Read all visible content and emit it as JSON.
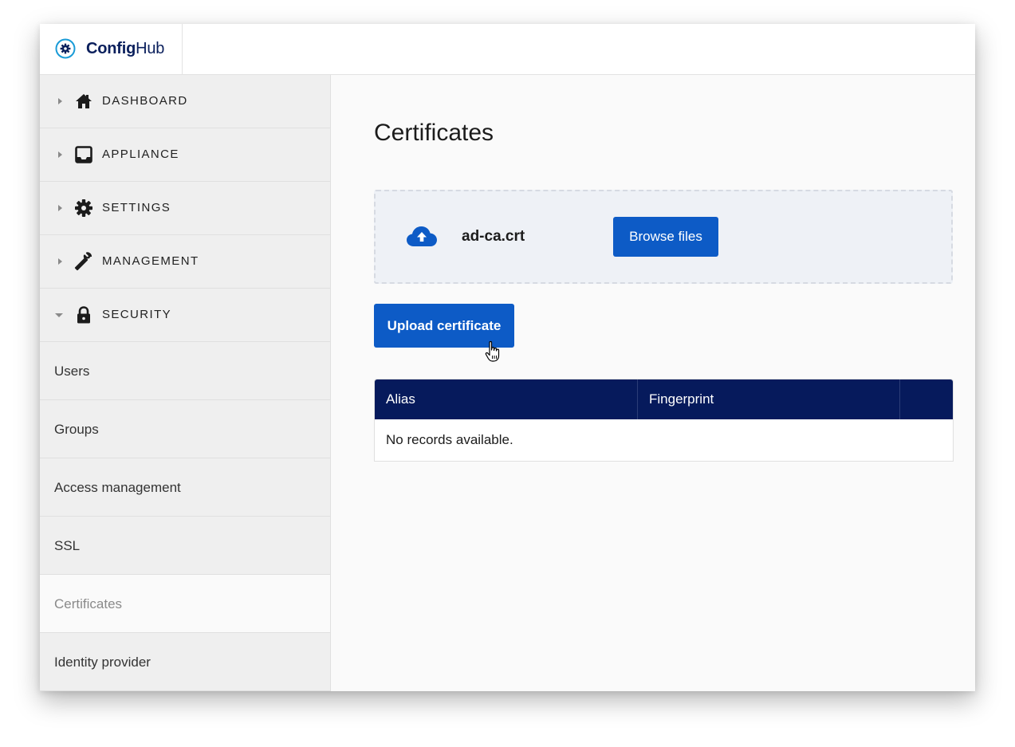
{
  "app": {
    "brand_bold": "Config",
    "brand_light": "Hub"
  },
  "sidebar": {
    "nav": [
      {
        "label": "DASHBOARD",
        "icon": "home-icon",
        "expanded": false
      },
      {
        "label": "APPLIANCE",
        "icon": "inbox-icon",
        "expanded": false
      },
      {
        "label": "SETTINGS",
        "icon": "gear-icon",
        "expanded": false
      },
      {
        "label": "MANAGEMENT",
        "icon": "wrench-icon",
        "expanded": false
      },
      {
        "label": "SECURITY",
        "icon": "lock-icon",
        "expanded": true
      }
    ],
    "security_items": [
      {
        "label": "Users",
        "active": false
      },
      {
        "label": "Groups",
        "active": false
      },
      {
        "label": "Access management",
        "active": false
      },
      {
        "label": "SSL",
        "active": false
      },
      {
        "label": "Certificates",
        "active": true
      },
      {
        "label": "Identity provider",
        "active": false
      }
    ]
  },
  "main": {
    "title": "Certificates",
    "dropzone": {
      "file_name": "ad-ca.crt",
      "browse_label": "Browse files"
    },
    "upload_label": "Upload certificate",
    "table": {
      "columns": [
        "Alias",
        "Fingerprint",
        ""
      ],
      "empty_message": "No records available."
    }
  },
  "colors": {
    "primary": "#0d5bc6",
    "table_header": "#061a5c",
    "brand": "#0a1f5c",
    "brand_icon": "#1a9bd7"
  }
}
